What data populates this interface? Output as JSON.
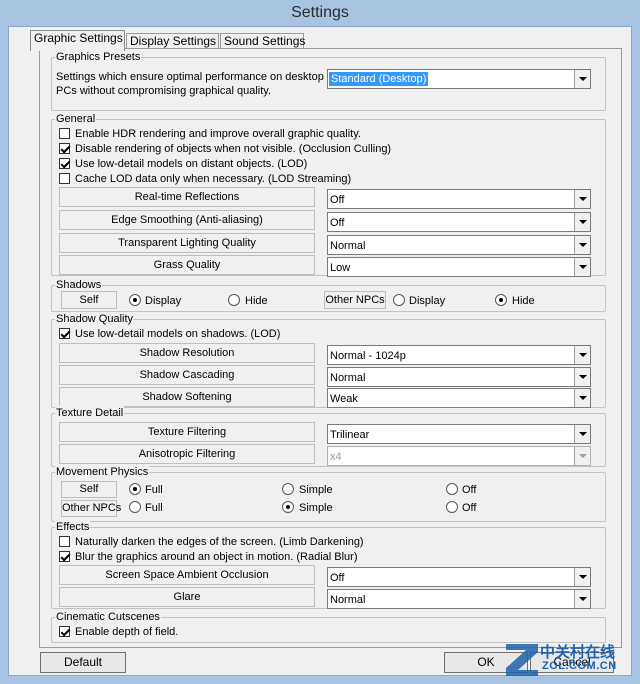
{
  "window": {
    "title": "Settings"
  },
  "tabs": [
    "Graphic Settings",
    "Display Settings",
    "Sound Settings"
  ],
  "presets": {
    "legend": "Graphics Presets",
    "description_line1": "Settings which ensure optimal performance on desktop",
    "description_line2": "PCs without compromising graphical quality.",
    "value": "Standard (Desktop)"
  },
  "general": {
    "legend": "General",
    "checkboxes": [
      {
        "label": "Enable HDR rendering and improve overall graphic quality.",
        "checked": false
      },
      {
        "label": "Disable rendering of objects when not visible. (Occlusion Culling)",
        "checked": true
      },
      {
        "label": "Use low-detail models on distant objects. (LOD)",
        "checked": true
      },
      {
        "label": "Cache LOD data only when necessary. (LOD Streaming)",
        "checked": false
      }
    ],
    "settings": [
      {
        "label": "Real-time Reflections",
        "value": "Off"
      },
      {
        "label": "Edge Smoothing (Anti-aliasing)",
        "value": "Off"
      },
      {
        "label": "Transparent Lighting Quality",
        "value": "Normal"
      },
      {
        "label": "Grass Quality",
        "value": "Low"
      }
    ]
  },
  "shadows": {
    "legend": "Shadows",
    "self_label": "Self",
    "npc_label": "Other NPCs",
    "display_label": "Display",
    "hide_label": "Hide",
    "self_selected": "Display",
    "npc_selected": "Hide"
  },
  "shadow_quality": {
    "legend": "Shadow Quality",
    "checkbox": {
      "label": "Use low-detail models on shadows. (LOD)",
      "checked": true
    },
    "settings": [
      {
        "label": "Shadow Resolution",
        "value": "Normal - 1024p"
      },
      {
        "label": "Shadow Cascading",
        "value": "Normal"
      },
      {
        "label": "Shadow Softening",
        "value": "Weak"
      }
    ]
  },
  "texture": {
    "legend": "Texture Detail",
    "settings": [
      {
        "label": "Texture Filtering",
        "value": "Trilinear",
        "disabled": false
      },
      {
        "label": "Anisotropic Filtering",
        "value": "x4",
        "disabled": true
      }
    ]
  },
  "physics": {
    "legend": "Movement Physics",
    "self_label": "Self",
    "npc_label": "Other NPCs",
    "options": [
      "Full",
      "Simple",
      "Off"
    ],
    "self_selected": "Full",
    "npc_selected": "Simple"
  },
  "effects": {
    "legend": "Effects",
    "checkboxes": [
      {
        "label": "Naturally darken the edges of the screen. (Limb Darkening)",
        "checked": false
      },
      {
        "label": "Blur the graphics around an object in motion. (Radial Blur)",
        "checked": true
      }
    ],
    "settings": [
      {
        "label": "Screen Space Ambient Occlusion",
        "value": "Off"
      },
      {
        "label": "Glare",
        "value": "Normal"
      }
    ]
  },
  "cinematic": {
    "legend": "Cinematic Cutscenes",
    "checkbox": {
      "label": "Enable depth of field.",
      "checked": true
    }
  },
  "buttons": {
    "default": "Default",
    "ok": "OK",
    "cancel": "Cancel"
  },
  "watermark": {
    "cn": "中关村在线",
    "en": "ZOL.COM.CN"
  }
}
